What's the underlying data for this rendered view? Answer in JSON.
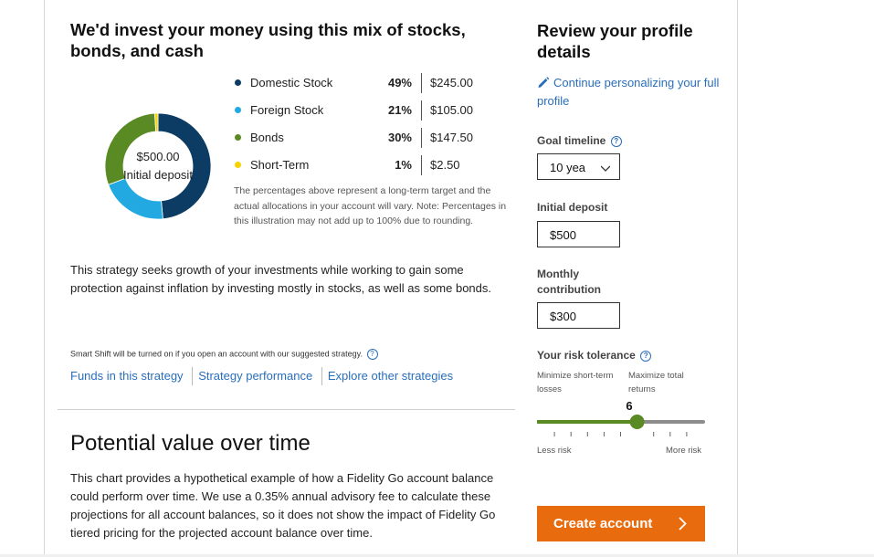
{
  "mix": {
    "title": "We'd invest your money using this mix of stocks, bonds, and cash",
    "center_amount": "$500.00",
    "center_label": "Initial deposit",
    "allocations": [
      {
        "name": "Domestic Stock",
        "percent": "49%",
        "amount": "$245.00",
        "value": 49,
        "color": "#0c3c63"
      },
      {
        "name": "Foreign Stock",
        "percent": "21%",
        "amount": "$105.00",
        "value": 21,
        "color": "#23a9e1"
      },
      {
        "name": "Bonds",
        "percent": "30%",
        "amount": "$147.50",
        "value": 30,
        "color": "#5a8a23"
      },
      {
        "name": "Short-Term",
        "percent": "1%",
        "amount": "$2.50",
        "value": 1,
        "color": "#f5d200"
      }
    ],
    "note": "The percentages above represent a long-term target and the actual allocations in your account will vary. Note: Percentages in this illustration may not add up to 100% due to rounding.",
    "strategy_text": "This strategy seeks growth of your investments while working to gain some protection against inflation by investing mostly in stocks, as well as some bonds.",
    "smart_shift": "Smart Shift will be turned on if you open an account with our suggested strategy.",
    "help_glyph": "?",
    "links": [
      "Funds in this strategy",
      "Strategy performance",
      "Explore other strategies"
    ]
  },
  "potential": {
    "title": "Potential value over time",
    "text": "This chart provides a hypothetical example of how a Fidelity Go account balance could perform over time. We use a 0.35% annual advisory fee to calculate these projections for all account balances, so it does not show the impact of Fidelity Go tiered pricing for the projected account balance over time."
  },
  "profile": {
    "title": "Review your profile details",
    "continue_link": "Continue personalizing your full profile",
    "goal_timeline_label": "Goal timeline",
    "goal_timeline_value": "10 yea",
    "initial_deposit_label": "Initial deposit",
    "initial_deposit_value": "$500",
    "monthly_contribution_label": "Monthly contribution",
    "monthly_contribution_value": "$300",
    "risk_label": "Your risk tolerance",
    "risk_min_label": "Minimize short-term losses",
    "risk_max_label": "Maximize total returns",
    "risk_value": "6",
    "risk_level": 6,
    "risk_max": 10,
    "less_risk": "Less risk",
    "more_risk": "More risk",
    "create_button": "Create account"
  },
  "colors": {
    "link": "#2a6ebb",
    "slider_active": "#5a8a23",
    "slider_inactive": "#8c8c8c",
    "button": "#e86c0e"
  }
}
